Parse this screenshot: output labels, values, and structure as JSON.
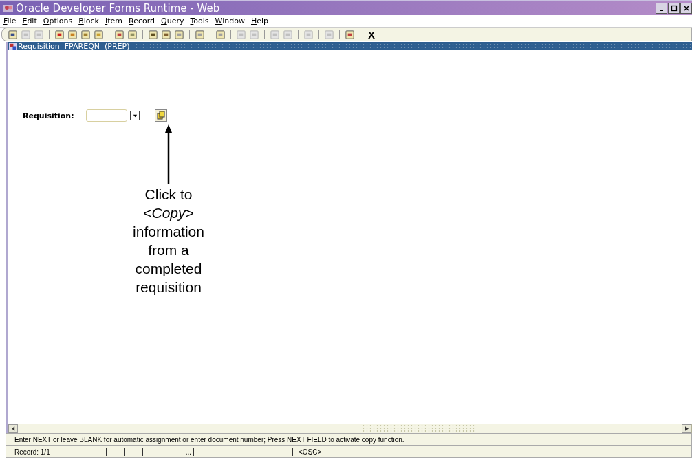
{
  "window": {
    "title": "Oracle Developer Forms Runtime - Web"
  },
  "menu": [
    "File",
    "Edit",
    "Options",
    "Block",
    "Item",
    "Record",
    "Query",
    "Tools",
    "Window",
    "Help"
  ],
  "toolbar": [
    {
      "kind": "icon",
      "disabled": false
    },
    {
      "kind": "icon",
      "disabled": true
    },
    {
      "kind": "icon",
      "disabled": true
    },
    {
      "kind": "sep"
    },
    {
      "kind": "icon",
      "disabled": false
    },
    {
      "kind": "icon",
      "disabled": false
    },
    {
      "kind": "icon",
      "disabled": false
    },
    {
      "kind": "icon",
      "disabled": false
    },
    {
      "kind": "sep"
    },
    {
      "kind": "icon",
      "disabled": false
    },
    {
      "kind": "icon",
      "disabled": false
    },
    {
      "kind": "sep"
    },
    {
      "kind": "icon",
      "disabled": false
    },
    {
      "kind": "icon",
      "disabled": false
    },
    {
      "kind": "icon",
      "disabled": false
    },
    {
      "kind": "sep"
    },
    {
      "kind": "icon",
      "disabled": false
    },
    {
      "kind": "sep"
    },
    {
      "kind": "icon",
      "disabled": false
    },
    {
      "kind": "sep"
    },
    {
      "kind": "icon",
      "disabled": true
    },
    {
      "kind": "icon",
      "disabled": true
    },
    {
      "kind": "sep"
    },
    {
      "kind": "icon",
      "disabled": true
    },
    {
      "kind": "icon",
      "disabled": true
    },
    {
      "kind": "sep"
    },
    {
      "kind": "icon",
      "disabled": true
    },
    {
      "kind": "sep"
    },
    {
      "kind": "icon",
      "disabled": true
    },
    {
      "kind": "sep"
    },
    {
      "kind": "icon",
      "disabled": false
    },
    {
      "kind": "sep"
    },
    {
      "kind": "text",
      "label": "X"
    }
  ],
  "form": {
    "title": "Requisition  FPAREQN  (PREP)",
    "field_label": "Requisition:"
  },
  "annotation": "Click to <*Copy*> information from a completed requisition",
  "status": {
    "message": "Enter NEXT or leave BLANK for automatic assignment or enter document number; Press NEXT FIELD to activate copy function.",
    "record": "Record: 1/1",
    "ellipsis": "...",
    "mode": "<OSC>"
  }
}
